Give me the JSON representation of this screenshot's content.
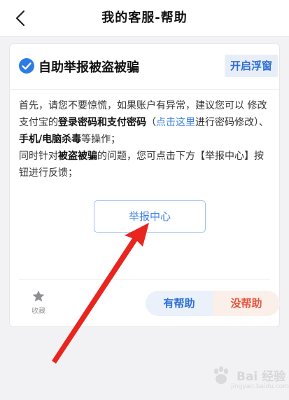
{
  "nav": {
    "title": "我的客服-帮助",
    "back_icon": "chevron-left-icon"
  },
  "card": {
    "title": "自助举报被盗被骗",
    "title_icon": "check-circle-icon",
    "float_window_label": "开启浮窗",
    "body": {
      "p1_part1": "首先，请您不要惊慌，如果账户有异常，建议您可以 修改支付宝的",
      "p1_bold1": "登录密码和支付密码",
      "p1_link_open": "（",
      "p1_link": "点击这里",
      "p1_part2": "进行密码修改）、",
      "p1_bold2": "手机/电脑杀毒",
      "p1_part3": "等操作；",
      "p2_part1": "同时针对",
      "p2_bold": "被盗被骗",
      "p2_part2": "的问题，您可点击下方【举报中心】按钮进行反馈；"
    },
    "report_center_label": "举报中心",
    "favorite_label": "收藏",
    "favorite_icon": "star-icon",
    "helpful_label": "有帮助",
    "not_helpful_label": "没帮助"
  },
  "watermark": {
    "text": "Bai 经验",
    "sub": "jingyan.baidu.com"
  },
  "colors": {
    "accent_blue": "#2d6fd6",
    "link_blue": "#3a7fe0",
    "annotation_red": "#e8261f",
    "not_helpful_red": "#e4553c"
  }
}
